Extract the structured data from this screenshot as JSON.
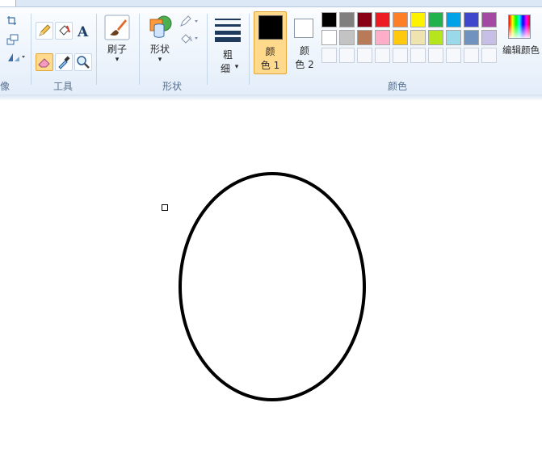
{
  "ribbon": {
    "image_group_label": "像",
    "tools_group_label": "工具",
    "brushes_label": "刷子",
    "shapes_button_label": "形状",
    "shapes_group_label": "形状",
    "size_label_line1": "粗",
    "size_label_line2": "细",
    "color1_line1": "颜",
    "color1_line2": "色 1",
    "color2_line1": "颜",
    "color2_line2": "色 2",
    "edit_colors_label": "编辑颜色",
    "colors_group_label": "颜色"
  },
  "palette": {
    "row1": [
      "#000000",
      "#7f7f7f",
      "#880015",
      "#ed1c24",
      "#ff7f27",
      "#fff200",
      "#22b14c",
      "#00a2e8",
      "#3f48cc",
      "#a349a4"
    ],
    "row2": [
      "#ffffff",
      "#c3c3c3",
      "#b97a57",
      "#ffaec9",
      "#ffc90e",
      "#efe4b0",
      "#b5e61d",
      "#99d9ea",
      "#7092be",
      "#c8bfe7"
    ],
    "row3": [
      "",
      "",
      "",
      "",
      "",
      "",
      "",
      "",
      "",
      ""
    ]
  },
  "state": {
    "color1": "#000000",
    "color2": "#ffffff",
    "active_tool": "eraser"
  }
}
